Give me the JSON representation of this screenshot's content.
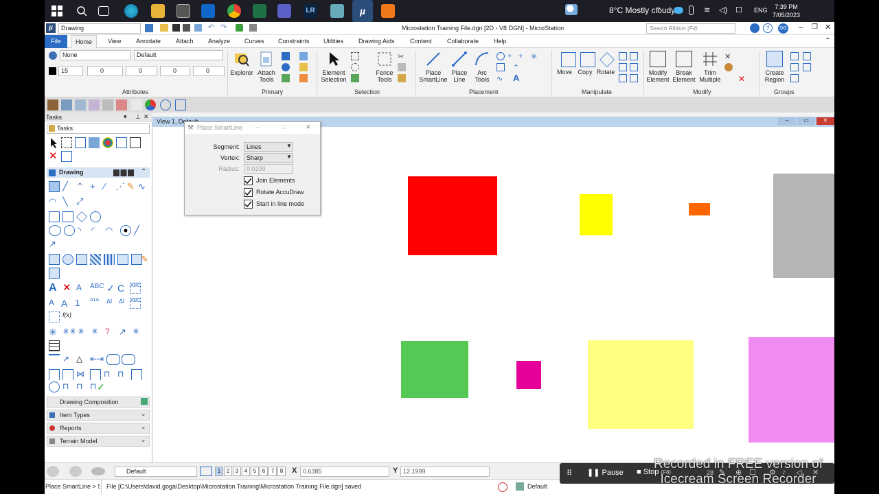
{
  "taskbar": {
    "weather": "8°C  Mostly cloudy",
    "language": "ENG",
    "time": "7:39 PM",
    "date": "7/05/2023",
    "app_badge": "LR"
  },
  "titlebar": {
    "workspace": "Drawing",
    "title": "Microstation Training File.dgn [2D - V8 DGN] - MicroStation",
    "search_placeholder": "Search Ribbon (F4)",
    "user_initials": "DG"
  },
  "menu": [
    "File",
    "Home",
    "View",
    "Annotate",
    "Attach",
    "Analyze",
    "Curves",
    "Constraints",
    "Utilities",
    "Drawing Aids",
    "Content",
    "Collaborate",
    "Help"
  ],
  "attributes": {
    "level": "None",
    "style": "Default",
    "color": "15",
    "weight": "0",
    "weight2": "0",
    "transparency": "0",
    "priority": "0",
    "label": "Attributes"
  },
  "primary": {
    "explorer": "Explorer",
    "attach_tools": "Attach Tools",
    "label": "Primary"
  },
  "selection": {
    "element_selection": "Element Selection",
    "fence_tools": "Fence Tools",
    "label": "Selection"
  },
  "placement": {
    "place_smartline": "Place SmartLine",
    "place_line": "Place Line",
    "arc_tools": "Arc Tools",
    "label": "Placement"
  },
  "manipulate": {
    "move": "Move",
    "copy": "Copy",
    "rotate": "Rotate",
    "label": "Manipulate"
  },
  "modify": {
    "modify_element": "Modify Element",
    "break_element": "Break Element",
    "trim_multiple": "Trim Multiple",
    "label": "Modify"
  },
  "groups": {
    "create_region": "Create Region",
    "label": "Groups"
  },
  "left_panel": {
    "header": "Tasks",
    "tasks_combo": "Tasks",
    "drawing_header": "Drawing",
    "sections": [
      "Drawing Composition",
      "Item Types",
      "Reports",
      "Terrain Model"
    ]
  },
  "view": {
    "title": "View 1, Default"
  },
  "dialog": {
    "title": "Place SmartLine",
    "segment_label": "Segment:",
    "segment_value": "Lines",
    "vertex_label": "Vertex:",
    "vertex_value": "Sharp",
    "radius_label": "Radius:",
    "radius_value": "0.0100",
    "join_elements": "Join Elements",
    "rotate_accudraw": "Rotate AccuDraw",
    "start_line_mode": "Start in line mode"
  },
  "status": {
    "model": "Default",
    "views": [
      "1",
      "2",
      "3",
      "4",
      "5",
      "6",
      "7",
      "8"
    ],
    "x_label": "X",
    "x_value": "0.6385",
    "y_label": "Y",
    "y_value": "12.1999",
    "tool_prompt": "Place SmartLine > S",
    "message": "File [C:\\Users\\david.goga\\Desktop\\Microstation Training\\Microstation Training File.dgn] saved",
    "level": "Default"
  },
  "recorder": {
    "pause": "Pause",
    "stop": "Stop",
    "stop_key": "(F8)",
    "counter": "28",
    "watermark_line1": "Recorded in FREE version of",
    "watermark_line2": "Icecream Screen Recorder"
  },
  "colors": {
    "red": "#ff0000",
    "yellow": "#ffff00",
    "orange": "#ff6600",
    "gray": "#b5b5b5",
    "green": "#55c855",
    "magenta": "#e6009a",
    "light_yellow": "#ffff80",
    "pink": "#f08cf0"
  }
}
